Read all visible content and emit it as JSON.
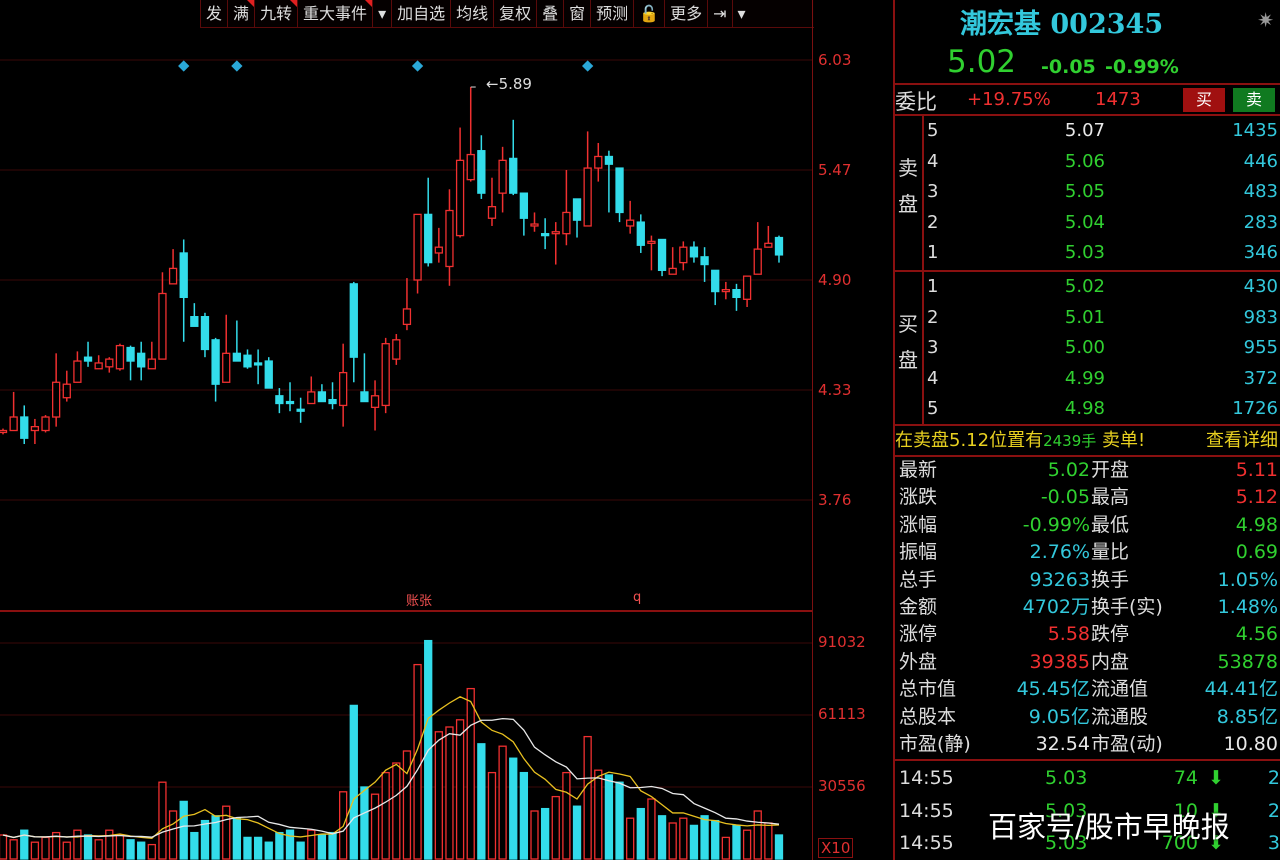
{
  "toolbar": {
    "items": [
      {
        "label": "发",
        "flag": false
      },
      {
        "label": "满",
        "flag": true
      },
      {
        "label": "九转",
        "flag": true
      },
      {
        "label": "重大事件",
        "flag": true
      },
      {
        "label": "▾",
        "flag": false
      },
      {
        "label": "加自选",
        "flag": false
      },
      {
        "label": "均线",
        "flag": false
      },
      {
        "label": "复权",
        "flag": false
      },
      {
        "label": "叠",
        "flag": false
      },
      {
        "label": "窗",
        "flag": false
      },
      {
        "label": "预测",
        "flag": false
      },
      {
        "label": "🔓",
        "flag": false
      },
      {
        "label": "更多",
        "flag": false
      },
      {
        "label": "⇥",
        "flag": false
      },
      {
        "label": "▾",
        "flag": false
      }
    ]
  },
  "price_axis": [
    "6.03",
    "5.47",
    "4.90",
    "4.33",
    "3.76"
  ],
  "volume_axis": [
    "91032",
    "61113",
    "30556",
    "X10"
  ],
  "chart_labels": {
    "high_marker": "5.89",
    "event1": "账张",
    "event2": "q"
  },
  "colors": {
    "up": "#f03030",
    "down": "#33dcea",
    "ma5": "#e8c020",
    "ma10": "#e8e8e8",
    "marker": "#2aa8d8"
  },
  "chart_data": {
    "type": "candlestick",
    "ylim": [
      3.76,
      6.03
    ],
    "markers_at_index": [
      17,
      22,
      39,
      55
    ],
    "ohlc": [
      [
        4.1,
        4.12,
        4.09,
        4.11
      ],
      [
        4.11,
        4.31,
        4.11,
        4.18
      ],
      [
        4.18,
        4.24,
        4.04,
        4.07
      ],
      [
        4.11,
        4.17,
        4.04,
        4.13
      ],
      [
        4.11,
        4.19,
        4.1,
        4.18
      ],
      [
        4.18,
        4.51,
        4.13,
        4.36
      ],
      [
        4.28,
        4.42,
        4.26,
        4.35
      ],
      [
        4.36,
        4.52,
        4.36,
        4.47
      ],
      [
        4.49,
        4.57,
        4.44,
        4.47
      ],
      [
        4.43,
        4.5,
        4.43,
        4.46
      ],
      [
        4.44,
        4.49,
        4.41,
        4.48
      ],
      [
        4.43,
        4.56,
        4.42,
        4.55
      ],
      [
        4.54,
        4.55,
        4.37,
        4.47
      ],
      [
        4.51,
        4.57,
        4.37,
        4.44
      ],
      [
        4.43,
        4.57,
        4.43,
        4.48
      ],
      [
        4.48,
        4.93,
        4.48,
        4.82
      ],
      [
        4.87,
        5.05,
        4.87,
        4.95
      ],
      [
        5.03,
        5.1,
        4.57,
        4.8
      ],
      [
        4.7,
        4.77,
        4.65,
        4.65
      ],
      [
        4.7,
        4.72,
        4.49,
        4.53
      ],
      [
        4.58,
        4.59,
        4.26,
        4.35
      ],
      [
        4.36,
        4.71,
        4.36,
        4.51
      ],
      [
        4.51,
        4.68,
        4.47,
        4.47
      ],
      [
        4.5,
        4.53,
        4.43,
        4.44
      ],
      [
        4.46,
        4.53,
        4.35,
        4.45
      ],
      [
        4.47,
        4.49,
        4.33,
        4.33
      ],
      [
        4.29,
        4.33,
        4.2,
        4.25
      ],
      [
        4.26,
        4.36,
        4.21,
        4.25
      ],
      [
        4.22,
        4.28,
        4.15,
        4.21
      ],
      [
        4.25,
        4.39,
        4.25,
        4.31
      ],
      [
        4.31,
        4.35,
        4.26,
        4.26
      ],
      [
        4.27,
        4.36,
        4.22,
        4.25
      ],
      [
        4.24,
        4.56,
        4.13,
        4.41
      ],
      [
        4.87,
        4.88,
        4.36,
        4.49
      ],
      [
        4.31,
        4.51,
        4.26,
        4.26
      ],
      [
        4.23,
        4.37,
        4.11,
        4.29
      ],
      [
        4.24,
        4.59,
        4.2,
        4.56
      ],
      [
        4.48,
        4.61,
        4.45,
        4.58
      ],
      [
        4.66,
        4.9,
        4.63,
        4.74
      ],
      [
        4.89,
        5.23,
        4.82,
        5.23
      ],
      [
        5.23,
        5.42,
        4.96,
        4.98
      ],
      [
        5.03,
        5.16,
        4.98,
        5.06
      ],
      [
        4.96,
        5.36,
        4.86,
        5.25
      ],
      [
        5.12,
        5.68,
        5.11,
        5.51
      ],
      [
        5.41,
        5.89,
        5.4,
        5.54
      ],
      [
        5.56,
        5.64,
        5.31,
        5.34
      ],
      [
        5.21,
        5.42,
        5.17,
        5.27
      ],
      [
        5.34,
        5.58,
        5.24,
        5.51
      ],
      [
        5.52,
        5.72,
        5.33,
        5.34
      ],
      [
        5.34,
        5.34,
        5.12,
        5.21
      ],
      [
        5.17,
        5.24,
        5.14,
        5.18
      ],
      [
        5.13,
        5.21,
        5.05,
        5.12
      ],
      [
        5.13,
        5.19,
        4.97,
        5.14
      ],
      [
        5.13,
        5.46,
        5.07,
        5.24
      ],
      [
        5.31,
        5.31,
        5.11,
        5.2
      ],
      [
        5.17,
        5.66,
        5.17,
        5.47
      ],
      [
        5.47,
        5.6,
        5.4,
        5.53
      ],
      [
        5.53,
        5.56,
        5.24,
        5.49
      ],
      [
        5.47,
        5.47,
        5.19,
        5.24
      ],
      [
        5.17,
        5.3,
        5.13,
        5.2
      ],
      [
        5.19,
        5.23,
        5.03,
        5.07
      ],
      [
        5.08,
        5.12,
        4.94,
        5.09
      ],
      [
        5.1,
        5.1,
        4.91,
        4.94
      ],
      [
        4.92,
        5.06,
        4.92,
        4.95
      ],
      [
        4.98,
        5.09,
        4.94,
        5.06
      ],
      [
        5.06,
        5.09,
        4.98,
        5.01
      ],
      [
        5.01,
        5.06,
        4.88,
        4.97
      ],
      [
        4.94,
        4.94,
        4.76,
        4.83
      ],
      [
        4.83,
        4.88,
        4.79,
        4.84
      ],
      [
        4.84,
        4.87,
        4.73,
        4.8
      ],
      [
        4.79,
        4.91,
        4.75,
        4.91
      ],
      [
        4.92,
        5.19,
        4.92,
        5.05
      ],
      [
        5.06,
        5.17,
        5.06,
        5.08
      ],
      [
        5.11,
        5.12,
        4.98,
        5.02
      ]
    ],
    "volume": [
      10000,
      8000,
      12000,
      7000,
      9000,
      11000,
      7000,
      12000,
      10000,
      8000,
      12000,
      10000,
      8000,
      7000,
      6000,
      32000,
      20000,
      24000,
      11000,
      16000,
      18000,
      22000,
      17000,
      9000,
      9000,
      7000,
      11000,
      12000,
      7000,
      12000,
      10000,
      11000,
      28000,
      64000,
      30000,
      27000,
      36000,
      40000,
      45000,
      81000,
      91000,
      53000,
      55000,
      58000,
      71000,
      48000,
      36000,
      47000,
      42000,
      36000,
      20000,
      21000,
      26000,
      36000,
      22000,
      51000,
      37000,
      35000,
      32000,
      17000,
      21000,
      25000,
      18000,
      15000,
      17000,
      14000,
      18000,
      16000,
      9000,
      14000,
      12000,
      20000,
      15000,
      10000
    ]
  },
  "quote": {
    "name": "潮宏基 002345",
    "price": "5.02",
    "change": "-0.05",
    "change_pct": "-0.99%",
    "weibi_label": "委比",
    "weibi": "+19.75%",
    "weicha": "1473",
    "buy_label": "买",
    "sell_label": "卖"
  },
  "orderbook": {
    "sell_side": [
      "卖",
      "盘"
    ],
    "buy_side": [
      "买",
      "盘"
    ],
    "asks": [
      {
        "level": "5",
        "price": "5.07",
        "vol": "1435"
      },
      {
        "level": "4",
        "price": "5.06",
        "vol": "446"
      },
      {
        "level": "3",
        "price": "5.05",
        "vol": "483"
      },
      {
        "level": "2",
        "price": "5.04",
        "vol": "283"
      },
      {
        "level": "1",
        "price": "5.03",
        "vol": "346"
      }
    ],
    "bids": [
      {
        "level": "1",
        "price": "5.02",
        "vol": "430"
      },
      {
        "level": "2",
        "price": "5.01",
        "vol": "983"
      },
      {
        "level": "3",
        "price": "5.00",
        "vol": "955"
      },
      {
        "level": "4",
        "price": "4.99",
        "vol": "372"
      },
      {
        "level": "5",
        "price": "4.98",
        "vol": "1726"
      }
    ]
  },
  "notice": {
    "text1": "在卖盘5.12位置有",
    "qty": "2439手",
    "text2": "卖单!",
    "detail": "查看详细"
  },
  "stats": [
    {
      "l1": "最新",
      "v1": "5.02",
      "c1": "g",
      "l2": "开盘",
      "v2": "5.11",
      "c2": "r"
    },
    {
      "l1": "涨跌",
      "v1": "-0.05",
      "c1": "g",
      "l2": "最高",
      "v2": "5.12",
      "c2": "r"
    },
    {
      "l1": "涨幅",
      "v1": "-0.99%",
      "c1": "g",
      "l2": "最低",
      "v2": "4.98",
      "c2": "g"
    },
    {
      "l1": "振幅",
      "v1": "2.76%",
      "c1": "c",
      "l2": "量比",
      "v2": "0.69",
      "c2": "g"
    },
    {
      "l1": "总手",
      "v1": "93263",
      "c1": "c",
      "l2": "换手",
      "v2": "1.05%",
      "c2": "c"
    },
    {
      "l1": "金额",
      "v1": "4702万",
      "c1": "c",
      "l2": "换手(实)",
      "v2": "1.48%",
      "c2": "c"
    },
    {
      "l1": "涨停",
      "v1": "5.58",
      "c1": "r",
      "l2": "跌停",
      "v2": "4.56",
      "c2": "g"
    },
    {
      "l1": "外盘",
      "v1": "39385",
      "c1": "r",
      "l2": "内盘",
      "v2": "53878",
      "c2": "g"
    },
    {
      "l1": "总市值",
      "v1": "45.45亿",
      "c1": "c",
      "l2": "流通值",
      "v2": "44.41亿",
      "c2": "c"
    },
    {
      "l1": "总股本",
      "v1": "9.05亿",
      "c1": "c",
      "l2": "流通股",
      "v2": "8.85亿",
      "c2": "c"
    },
    {
      "l1": "市盈(静)",
      "v1": "32.54",
      "c1": "w",
      "l2": "市盈(动)",
      "v2": "10.80",
      "c2": "w"
    }
  ],
  "trades": [
    {
      "time": "14:55",
      "price": "5.03",
      "vol": "74",
      "arrow": "⬇",
      "count": "2"
    },
    {
      "time": "14:55",
      "price": "5.03",
      "vol": "10",
      "arrow": "⬇",
      "count": "2"
    },
    {
      "time": "14:55",
      "price": "5.03",
      "vol": "700",
      "arrow": "⬇",
      "count": "3"
    }
  ],
  "watermark": "百家号/股市早晚报"
}
